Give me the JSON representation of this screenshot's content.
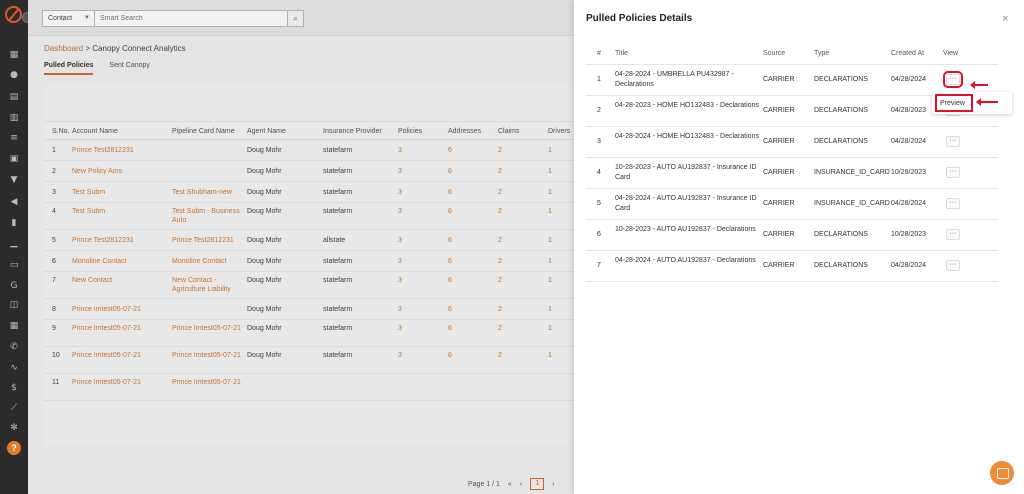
{
  "topbar": {
    "search_select": "Contact",
    "search_placeholder": "Smart Search"
  },
  "breadcrumb": {
    "link": "Dashboard",
    "separator": ">",
    "current": "Canopy Connect Analytics"
  },
  "subtabs": [
    {
      "label": "Pulled Policies",
      "active": true
    },
    {
      "label": "Sent Canopy",
      "active": false
    }
  ],
  "background_table": {
    "headers": [
      "S.No.",
      "Account Name",
      "Pipeline Card Name",
      "Agent Name",
      "Insurance Provider",
      "Policies",
      "Addresses",
      "Claims",
      "Drivers"
    ],
    "rows": [
      [
        "1",
        "Prince Test2812231",
        "",
        "Doug Mohr",
        "statefarm",
        "3",
        "6",
        "2",
        "1"
      ],
      [
        "2",
        "New Policy Ams",
        "",
        "Doug Mohr",
        "statefarm",
        "3",
        "6",
        "2",
        "1"
      ],
      [
        "3",
        "Test Subm",
        "Test Shubham-new",
        "Doug Mohr",
        "statefarm",
        "3",
        "6",
        "2",
        "1"
      ],
      [
        "4",
        "Test Subm",
        "Test Subm - Business Auto",
        "Doug Mohr",
        "statefarm",
        "3",
        "6",
        "2",
        "1"
      ],
      [
        "5",
        "Prince Test2812231",
        "Prince Test2812231",
        "Doug Mohr",
        "allstate",
        "3",
        "6",
        "2",
        "1"
      ],
      [
        "6",
        "Monoline Contact",
        "Monoline Contact",
        "Doug Mohr",
        "statefarm",
        "3",
        "6",
        "2",
        "1"
      ],
      [
        "7",
        "New Contact",
        "New Contact - Agriculture Liability",
        "Doug Mohr",
        "statefarm",
        "3",
        "6",
        "2",
        "1"
      ],
      [
        "8",
        "Prince Imtest05-07-21",
        "",
        "Doug Mohr",
        "statefarm",
        "3",
        "6",
        "2",
        "1"
      ],
      [
        "9",
        "Prince Imtest05-07-21",
        "Prince Imtest05-07-21",
        "Doug Mohr",
        "statefarm",
        "3",
        "6",
        "2",
        "1"
      ],
      [
        "10",
        "Prince Imtest05-07-21",
        "Prince Imtest05-07-21",
        "Doug Mohr",
        "statefarm",
        "3",
        "6",
        "2",
        "1"
      ],
      [
        "11",
        "Prince Imtest05-07-21",
        "Prince Imtest05-07-21",
        "",
        "",
        "",
        "",
        "",
        ""
      ]
    ]
  },
  "pager": {
    "text": "Page 1 / 1",
    "current": "1"
  },
  "panel": {
    "title": "Pulled Policies Details",
    "close": "×",
    "headers": {
      "num": "#",
      "title": "Title",
      "source": "Source",
      "type": "Type",
      "created": "Created At",
      "view": "View"
    },
    "rows": [
      {
        "num": "1",
        "title": "04-28-2024 - UMBRELLA PU432987 - Declarations",
        "source": "CARRIER",
        "type": "DECLARATIONS",
        "created": "04/28/2024"
      },
      {
        "num": "2",
        "title": "04-28-2023 - HOME HO132483 - Declarations",
        "source": "CARRIER",
        "type": "DECLARATIONS",
        "created": "04/28/2023"
      },
      {
        "num": "3",
        "title": "04-28-2024 - HOME HO132483 - Declarations",
        "source": "CARRIER",
        "type": "DECLARATIONS",
        "created": "04/28/2024"
      },
      {
        "num": "4",
        "title": "10-28-2023 - AUTO AU192837 - Insurance ID Card",
        "source": "CARRIER",
        "type": "INSURANCE_ID_CARD",
        "created": "10/28/2023"
      },
      {
        "num": "5",
        "title": "04-28-2024 - AUTO AU192837 - Insurance ID Card",
        "source": "CARRIER",
        "type": "INSURANCE_ID_CARD",
        "created": "04/28/2024"
      },
      {
        "num": "6",
        "title": "10-28-2023 - AUTO AU192837 - Declarations",
        "source": "CARRIER",
        "type": "DECLARATIONS",
        "created": "10/28/2023"
      },
      {
        "num": "7",
        "title": "04-28-2024 - AUTO AU192837 - Declarations",
        "source": "CARRIER",
        "type": "DECLARATIONS",
        "created": "04/28/2024"
      }
    ],
    "view_button": "···",
    "preview_label": "Preview"
  },
  "help_badge": "?",
  "colors": {
    "accent": "#d4682b",
    "highlight": "#e0102a",
    "chat": "#f08a35"
  }
}
